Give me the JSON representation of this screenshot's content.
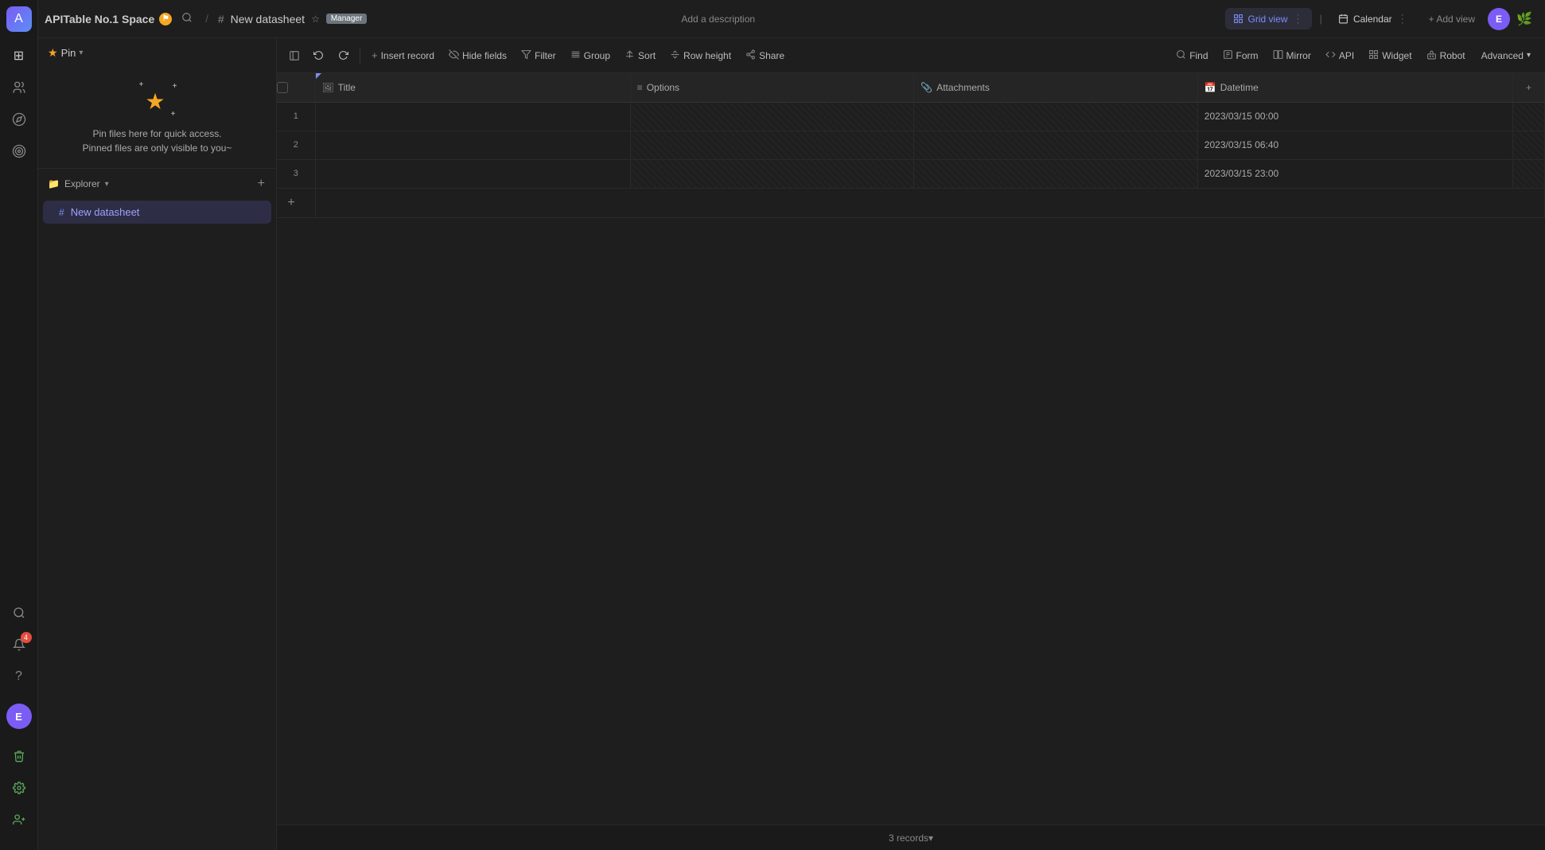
{
  "app": {
    "logo_letter": "A",
    "space_name": "APITable No.1 Space",
    "space_verified": "⚑"
  },
  "top_bar": {
    "sheet_name": "New datasheet",
    "sheet_badge": "Manager",
    "description_placeholder": "Add a description",
    "search_icon": "🔍"
  },
  "views": {
    "grid_view_label": "Grid view",
    "calendar_label": "Calendar",
    "add_view_label": "+ Add view"
  },
  "toolbar": {
    "collapse_icon": "◀",
    "undo_icon": "↩",
    "redo_icon": "↪",
    "insert_record_label": "Insert record",
    "hide_fields_label": "Hide fields",
    "filter_label": "Filter",
    "group_label": "Group",
    "sort_label": "Sort",
    "row_height_label": "Row height",
    "share_label": "Share"
  },
  "grid_tools": {
    "find_label": "Find",
    "form_label": "Form",
    "mirror_label": "Mirror",
    "api_label": "API",
    "widget_label": "Widget",
    "robot_label": "Robot",
    "advanced_label": "Advanced"
  },
  "columns": [
    {
      "id": "title",
      "icon": "🖼",
      "label": "Title"
    },
    {
      "id": "options",
      "icon": "≡",
      "label": "Options"
    },
    {
      "id": "attachments",
      "icon": "📎",
      "label": "Attachments"
    },
    {
      "id": "datetime",
      "icon": "📅",
      "label": "Datetime"
    }
  ],
  "rows": [
    {
      "row_num": "1",
      "datetime": "2023/03/15 00:00"
    },
    {
      "row_num": "2",
      "datetime": "2023/03/15 06:40"
    },
    {
      "row_num": "3",
      "datetime": "2023/03/15 23:00"
    }
  ],
  "sidebar": {
    "pin_label": "Pin",
    "explorer_label": "Explorer",
    "hint_line1": "Pin files here for quick access.",
    "hint_line2": "Pinned files are only visible to you~",
    "datasheet_name": "New datasheet"
  },
  "status_bar": {
    "record_count": "3 records▾"
  },
  "user": {
    "avatar_letter": "E"
  },
  "left_nav": {
    "icons": [
      {
        "name": "home-icon",
        "symbol": "⊞"
      },
      {
        "name": "people-icon",
        "symbol": "👥"
      },
      {
        "name": "explore-icon",
        "symbol": "🧭"
      },
      {
        "name": "target-icon",
        "symbol": "◎"
      }
    ],
    "bottom_icons": [
      {
        "name": "search-icon",
        "symbol": "🔍"
      },
      {
        "name": "notification-icon",
        "symbol": "🔔",
        "badge": "4"
      },
      {
        "name": "help-icon",
        "symbol": "?"
      }
    ]
  }
}
